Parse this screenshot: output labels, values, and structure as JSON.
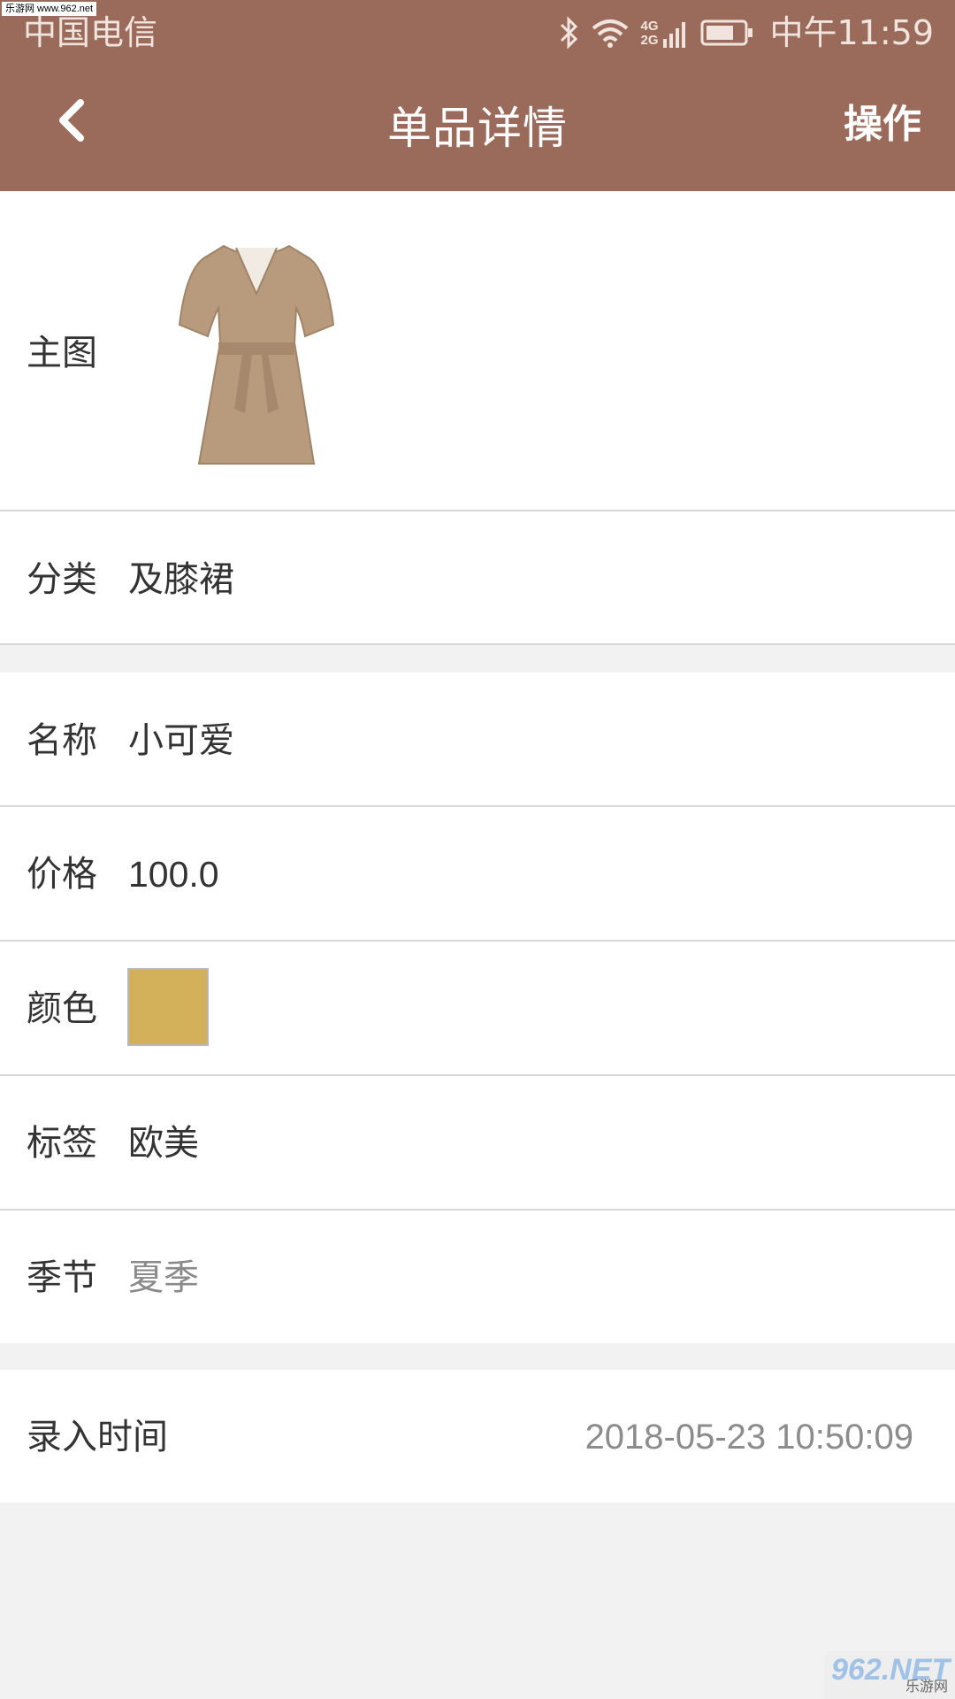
{
  "status_bar": {
    "watermark": "乐游网 www.962.net",
    "carrier": "中国电信",
    "network": "4G 2G",
    "time": "中午11:59"
  },
  "nav": {
    "title": "单品详情",
    "action": "操作"
  },
  "details": {
    "image_label": "主图",
    "category_label": "分类",
    "category_value": "及膝裙",
    "name_label": "名称",
    "name_value": "小可爱",
    "price_label": "价格",
    "price_value": "100.0",
    "color_label": "颜色",
    "color_hex": "#d3b15a",
    "tag_label": "标签",
    "tag_value": "欧美",
    "season_label": "季节",
    "season_value": "夏季",
    "entry_time_label": "录入时间",
    "entry_time_value": "2018-05-23 10:50:09"
  },
  "watermark_br": {
    "big": "962.NET",
    "small": "乐游网"
  },
  "colors": {
    "header": "#9a6b5a",
    "page_bg": "#f2f2f2",
    "dress": "#b89a7d"
  }
}
